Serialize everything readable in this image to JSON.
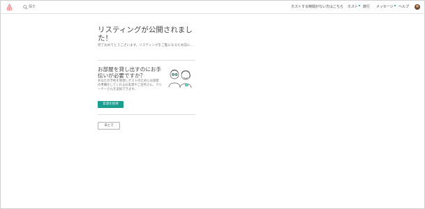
{
  "header": {
    "search_placeholder": "探す",
    "nav": {
      "host_link": "ホストする時間がない方はこちら",
      "host": "ホスト",
      "trips": "旅行",
      "messages": "メッセージ",
      "help": "ヘルプ"
    }
  },
  "main": {
    "title": "リスティングが公開されました！",
    "subtitle": "完了おめでとうございます。リスティングをご覧になるため前に…",
    "cohost_section": {
      "title": "お部屋を貸し出すのにお手伝いが必要ですか？",
      "description": "あなたの予約を管理しゲストのためにお部屋の準備をしてくれるお友達やご近所さん、クリーナーさんを追加できます。",
      "invite_button": "友達を招待"
    },
    "later_button": "あとで"
  },
  "colors": {
    "accent": "#1a9e8f",
    "brand": "#ff5a5f"
  },
  "icons": {
    "logo": "airbnb-logo-icon",
    "search": "search-icon"
  }
}
